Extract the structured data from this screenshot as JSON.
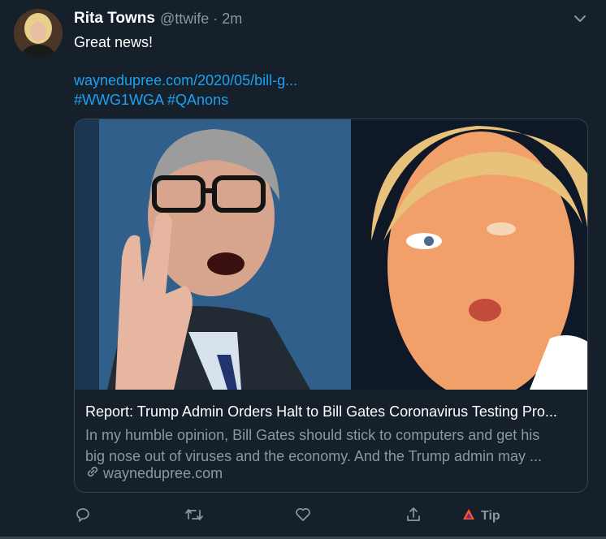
{
  "tweet": {
    "author_name": "Rita Towns",
    "handle": "@ttwife",
    "separator": "·",
    "time": "2m",
    "text": "Great news!",
    "link_text": "waynedupree.com/2020/05/bill-g...",
    "hashtags": [
      "#WWG1WGA",
      "#QAnons"
    ]
  },
  "card": {
    "title": "Report: Trump Admin Orders Halt to Bill Gates Coronavirus Testing Pro...",
    "description_line1": "In my humble opinion, Bill Gates should stick to computers and get his",
    "description_line2": "big nose out of viruses and the economy. And the Trump admin may ...",
    "domain": "waynedupree.com"
  },
  "actions": {
    "reply_icon": "reply-icon",
    "retweet_icon": "retweet-icon",
    "like_icon": "heart-icon",
    "share_icon": "share-icon",
    "tip_icon": "tip-icon",
    "tip_label": "Tip"
  },
  "colors": {
    "background": "#15202b",
    "accent": "#1da1f2",
    "secondary_text": "#8899a6",
    "border": "#38444d"
  }
}
